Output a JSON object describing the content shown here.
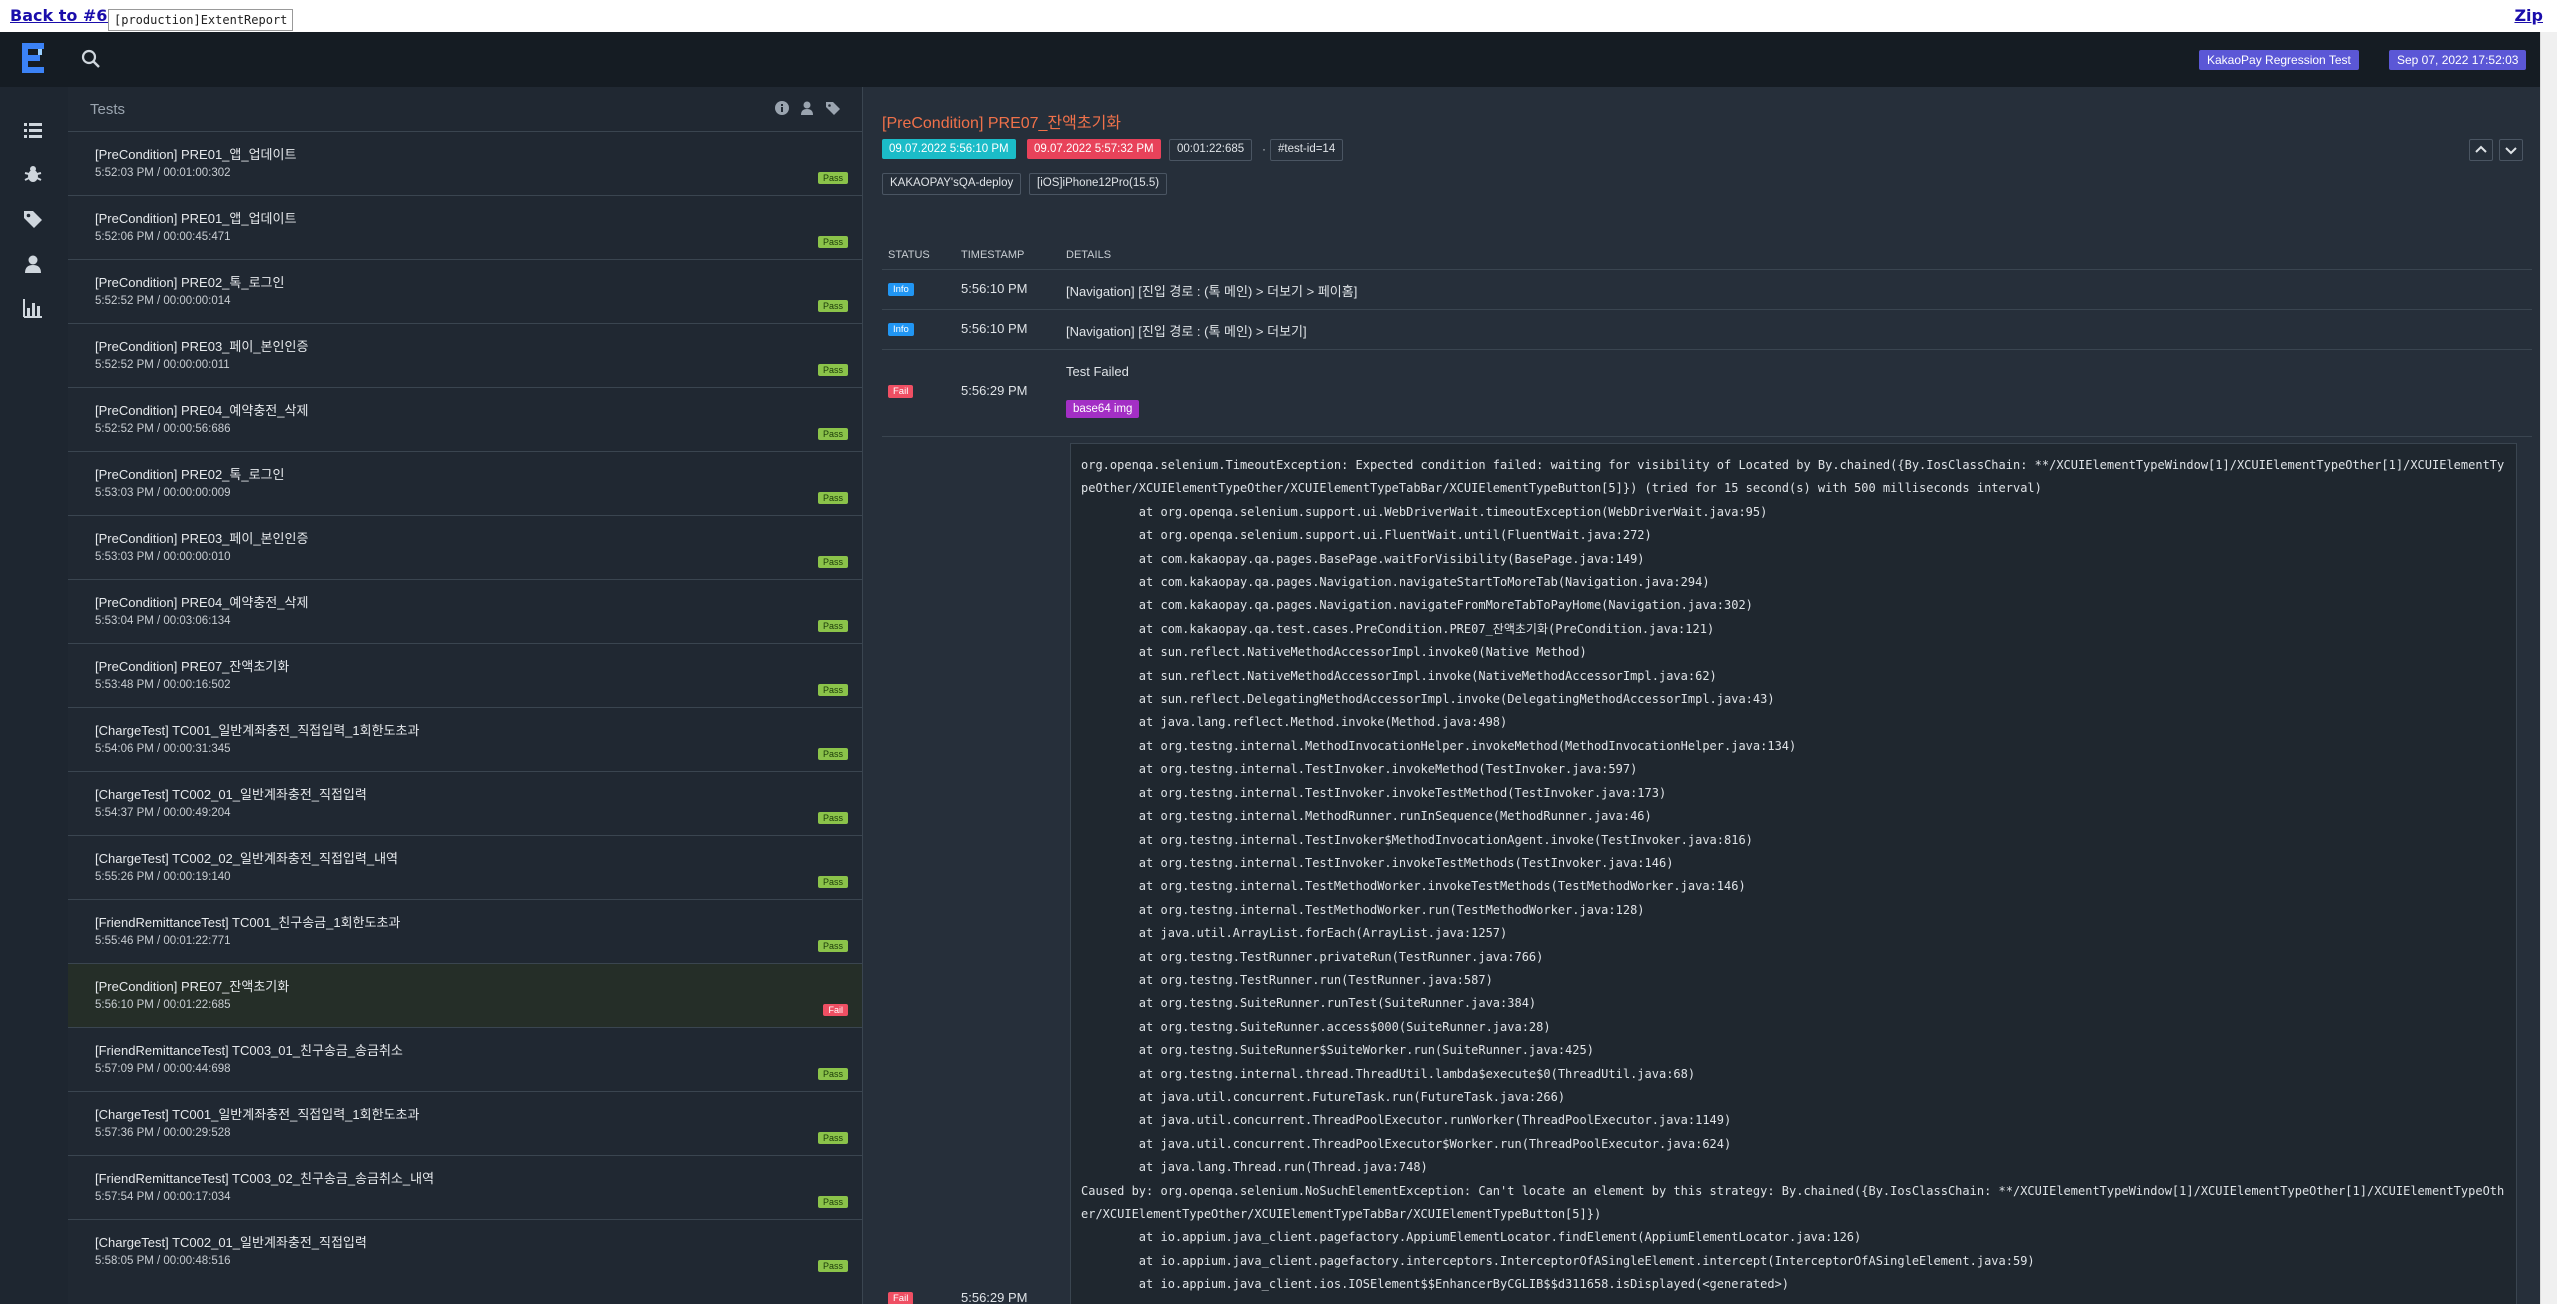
{
  "topbar": {
    "back": "Back to #65",
    "tab": "[production]ExtentReport",
    "zip": "Zip"
  },
  "header": {
    "badge_suite": "KakaoPay Regression Test",
    "badge_date": "Sep 07, 2022 17:52:03"
  },
  "colors": {
    "pass": "#8bc34a",
    "fail": "#ef4f63",
    "info": "#2196f3",
    "title": "#f0714a",
    "start": "#1bbcc8",
    "end": "#e8425a",
    "base64": "#a32fc5"
  },
  "list": {
    "title": "Tests",
    "items": [
      {
        "name": "[PreCondition] PRE01_앱_업데이트",
        "time": "5:52:03 PM / 00:01:00:302",
        "status": "Pass"
      },
      {
        "name": "[PreCondition] PRE01_앱_업데이트",
        "time": "5:52:06 PM / 00:00:45:471",
        "status": "Pass"
      },
      {
        "name": "[PreCondition] PRE02_톡_로그인",
        "time": "5:52:52 PM / 00:00:00:014",
        "status": "Pass"
      },
      {
        "name": "[PreCondition] PRE03_페이_본인인증",
        "time": "5:52:52 PM / 00:00:00:011",
        "status": "Pass"
      },
      {
        "name": "[PreCondition] PRE04_예약충전_삭제",
        "time": "5:52:52 PM / 00:00:56:686",
        "status": "Pass"
      },
      {
        "name": "[PreCondition] PRE02_톡_로그인",
        "time": "5:53:03 PM / 00:00:00:009",
        "status": "Pass"
      },
      {
        "name": "[PreCondition] PRE03_페이_본인인증",
        "time": "5:53:03 PM / 00:00:00:010",
        "status": "Pass"
      },
      {
        "name": "[PreCondition] PRE04_예약충전_삭제",
        "time": "5:53:04 PM / 00:03:06:134",
        "status": "Pass"
      },
      {
        "name": "[PreCondition] PRE07_잔액초기화",
        "time": "5:53:48 PM / 00:00:16:502",
        "status": "Pass"
      },
      {
        "name": "[ChargeTest] TC001_일반계좌충전_직접입력_1회한도초과",
        "time": "5:54:06 PM / 00:00:31:345",
        "status": "Pass"
      },
      {
        "name": "[ChargeTest] TC002_01_일반계좌충전_직접입력",
        "time": "5:54:37 PM / 00:00:49:204",
        "status": "Pass"
      },
      {
        "name": "[ChargeTest] TC002_02_일반계좌충전_직접입력_내역",
        "time": "5:55:26 PM / 00:00:19:140",
        "status": "Pass"
      },
      {
        "name": "[FriendRemittanceTest] TC001_친구송금_1회한도초과",
        "time": "5:55:46 PM / 00:01:22:771",
        "status": "Pass"
      },
      {
        "name": "[PreCondition] PRE07_잔액초기화",
        "time": "5:56:10 PM / 00:01:22:685",
        "status": "Fail"
      },
      {
        "name": "[FriendRemittanceTest] TC003_01_친구송금_송금취소",
        "time": "5:57:09 PM / 00:00:44:698",
        "status": "Pass"
      },
      {
        "name": "[ChargeTest] TC001_일반계좌충전_직접입력_1회한도초과",
        "time": "5:57:36 PM / 00:00:29:528",
        "status": "Pass"
      },
      {
        "name": "[FriendRemittanceTest] TC003_02_친구송금_송금취소_내역",
        "time": "5:57:54 PM / 00:00:17:034",
        "status": "Pass"
      },
      {
        "name": "[ChargeTest] TC002_01_일반계좌충전_직접입력",
        "time": "5:58:05 PM / 00:00:48:516",
        "status": "Pass"
      }
    ]
  },
  "detail": {
    "title": "[PreCondition] PRE07_잔액초기화",
    "start": "09.07.2022 5:56:10 PM",
    "end": "09.07.2022 5:57:32 PM",
    "duration": "00:01:22:685",
    "dot": "·",
    "test_id": "#test-id=14",
    "tag1": "KAKAOPAY'sQA-deploy",
    "tag2": "[iOS]iPhone12Pro(15.5)",
    "headers": {
      "status": "STATUS",
      "timestamp": "TIMESTAMP",
      "details": "DETAILS"
    },
    "logs": [
      {
        "status": "Info",
        "time": "5:56:10 PM",
        "details": "[Navigation] [진입 경로 : (톡 메인) > 더보기 > 페이홈]"
      },
      {
        "status": "Info",
        "time": "5:56:10 PM",
        "details": "[Navigation] [진입 경로 : (톡 메인) > 더보기]"
      },
      {
        "status": "Fail",
        "time": "5:56:29 PM",
        "details": "Test Failed",
        "extra": "base64 img"
      }
    ],
    "stacktrace": "org.openqa.selenium.TimeoutException: Expected condition failed: waiting for visibility of Located by By.chained({By.IosClassChain: **/XCUIElementTypeWindow[1]/XCUIElementTypeOther[1]/XCUIElementTypeOther/XCUIElementTypeOther/XCUIElementTypeTabBar/XCUIElementTypeButton[5]}) (tried for 15 second(s) with 500 milliseconds interval)\n\tat org.openqa.selenium.support.ui.WebDriverWait.timeoutException(WebDriverWait.java:95)\n\tat org.openqa.selenium.support.ui.FluentWait.until(FluentWait.java:272)\n\tat com.kakaopay.qa.pages.BasePage.waitForVisibility(BasePage.java:149)\n\tat com.kakaopay.qa.pages.Navigation.navigateStartToMoreTab(Navigation.java:294)\n\tat com.kakaopay.qa.pages.Navigation.navigateFromMoreTabToPayHome(Navigation.java:302)\n\tat com.kakaopay.qa.test.cases.PreCondition.PRE07_잔액초기화(PreCondition.java:121)\n\tat sun.reflect.NativeMethodAccessorImpl.invoke0(Native Method)\n\tat sun.reflect.NativeMethodAccessorImpl.invoke(NativeMethodAccessorImpl.java:62)\n\tat sun.reflect.DelegatingMethodAccessorImpl.invoke(DelegatingMethodAccessorImpl.java:43)\n\tat java.lang.reflect.Method.invoke(Method.java:498)\n\tat org.testng.internal.MethodInvocationHelper.invokeMethod(MethodInvocationHelper.java:134)\n\tat org.testng.internal.TestInvoker.invokeMethod(TestInvoker.java:597)\n\tat org.testng.internal.TestInvoker.invokeTestMethod(TestInvoker.java:173)\n\tat org.testng.internal.MethodRunner.runInSequence(MethodRunner.java:46)\n\tat org.testng.internal.TestInvoker$MethodInvocationAgent.invoke(TestInvoker.java:816)\n\tat org.testng.internal.TestInvoker.invokeTestMethods(TestInvoker.java:146)\n\tat org.testng.internal.TestMethodWorker.invokeTestMethods(TestMethodWorker.java:146)\n\tat org.testng.internal.TestMethodWorker.run(TestMethodWorker.java:128)\n\tat java.util.ArrayList.forEach(ArrayList.java:1257)\n\tat org.testng.TestRunner.privateRun(TestRunner.java:766)\n\tat org.testng.TestRunner.run(TestRunner.java:587)\n\tat org.testng.SuiteRunner.runTest(SuiteRunner.java:384)\n\tat org.testng.SuiteRunner.access$000(SuiteRunner.java:28)\n\tat org.testng.SuiteRunner$SuiteWorker.run(SuiteRunner.java:425)\n\tat org.testng.internal.thread.ThreadUtil.lambda$execute$0(ThreadUtil.java:68)\n\tat java.util.concurrent.FutureTask.run(FutureTask.java:266)\n\tat java.util.concurrent.ThreadPoolExecutor.runWorker(ThreadPoolExecutor.java:1149)\n\tat java.util.concurrent.ThreadPoolExecutor$Worker.run(ThreadPoolExecutor.java:624)\n\tat java.lang.Thread.run(Thread.java:748)\nCaused by: org.openqa.selenium.NoSuchElementException: Can't locate an element by this strategy: By.chained({By.IosClassChain: **/XCUIElementTypeWindow[1]/XCUIElementTypeOther[1]/XCUIElementTypeOther/XCUIElementTypeOther/XCUIElementTypeTabBar/XCUIElementTypeButton[5]})\n\tat io.appium.java_client.pagefactory.AppiumElementLocator.findElement(AppiumElementLocator.java:126)\n\tat io.appium.java_client.pagefactory.interceptors.InterceptorOfASingleElement.intercept(InterceptorOfASingleElement.java:59)\n\tat io.appium.java_client.ios.IOSElement$$EnhancerByCGLIB$$d311658.isDisplayed(<generated>)",
    "last_row_time": "5:56:29 PM",
    "last_row_status": "Fail"
  },
  "icons": [
    "logo-icon",
    "search-icon",
    "list-icon",
    "bug-icon",
    "tag-icon",
    "user-icon",
    "bar-chart-icon",
    "info-circle-icon",
    "chevron-up-icon",
    "chevron-down-icon"
  ]
}
